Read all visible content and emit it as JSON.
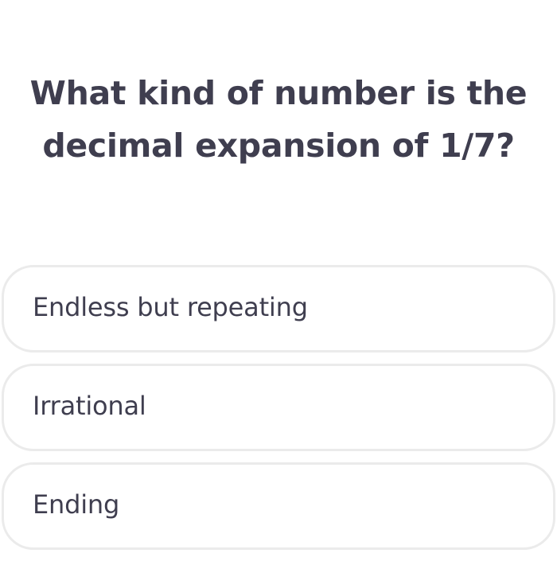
{
  "question": {
    "line1": "What kind of number is the",
    "line2": "decimal expansion of 1/7?"
  },
  "options": [
    {
      "label": "Endless but repeating"
    },
    {
      "label": "Irrational"
    },
    {
      "label": "Ending"
    }
  ],
  "colors": {
    "text": "#3f3e4f",
    "option_border": "#ebebeb",
    "background": "#ffffff"
  }
}
